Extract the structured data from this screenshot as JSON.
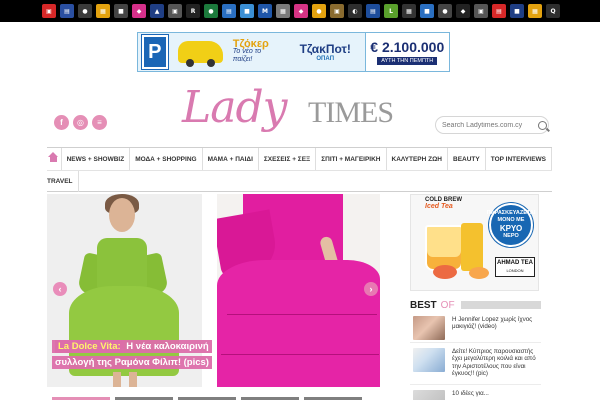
{
  "site_bar": {
    "icons": [
      {
        "name": "site-icon-1",
        "color": "#d62828",
        "glyph": "▣"
      },
      {
        "name": "site-icon-2",
        "color": "#2a4fa1",
        "glyph": "▤"
      },
      {
        "name": "site-icon-3",
        "color": "#3a3a3a",
        "glyph": "●"
      },
      {
        "name": "site-icon-4",
        "color": "#e3a20f",
        "glyph": "▦"
      },
      {
        "name": "site-icon-5",
        "color": "#444444",
        "glyph": "■"
      },
      {
        "name": "site-icon-6",
        "color": "#d6308a",
        "glyph": "◆"
      },
      {
        "name": "site-icon-7",
        "color": "#1f3e84",
        "glyph": "▲"
      },
      {
        "name": "site-icon-8",
        "color": "#555555",
        "glyph": "▣"
      },
      {
        "name": "site-icon-9",
        "color": "#222222",
        "glyph": "R"
      },
      {
        "name": "site-icon-10",
        "color": "#1c7a3c",
        "glyph": "●"
      },
      {
        "name": "site-icon-11",
        "color": "#2a6fc1",
        "glyph": "▤"
      },
      {
        "name": "site-icon-12",
        "color": "#3b8fd4",
        "glyph": "■"
      },
      {
        "name": "site-icon-13",
        "color": "#1f56a8",
        "glyph": "M"
      },
      {
        "name": "site-icon-14",
        "color": "#7a7a7a",
        "glyph": "▦"
      },
      {
        "name": "site-icon-15",
        "color": "#d63384",
        "glyph": "◆"
      },
      {
        "name": "site-icon-16",
        "color": "#e3a20f",
        "glyph": "●"
      },
      {
        "name": "site-icon-17",
        "color": "#8a6b2f",
        "glyph": "▣"
      },
      {
        "name": "site-icon-18",
        "color": "#2e2e2e",
        "glyph": "◐"
      },
      {
        "name": "site-icon-19",
        "color": "#1d4d9c",
        "glyph": "▤"
      },
      {
        "name": "site-icon-20",
        "color": "#5aa02c",
        "glyph": "L"
      },
      {
        "name": "site-icon-21",
        "color": "#333333",
        "glyph": "▦"
      },
      {
        "name": "site-icon-22",
        "color": "#2a6fc1",
        "glyph": "■"
      },
      {
        "name": "site-icon-23",
        "color": "#444444",
        "glyph": "●"
      },
      {
        "name": "site-icon-24",
        "color": "#222222",
        "glyph": "◆"
      },
      {
        "name": "site-icon-25",
        "color": "#555555",
        "glyph": "▣"
      },
      {
        "name": "site-icon-26",
        "color": "#d62828",
        "glyph": "▤"
      },
      {
        "name": "site-icon-27",
        "color": "#1f3e84",
        "glyph": "■"
      },
      {
        "name": "site-icon-28",
        "color": "#e3a20f",
        "glyph": "▦"
      },
      {
        "name": "site-icon-29",
        "color": "#2e2e2e",
        "glyph": "Q"
      }
    ]
  },
  "banner": {
    "sign": "P",
    "brand": "Τζόκερ",
    "slogan": "Το νέο το παίζει!",
    "headline": "ΤζακΠοτ!",
    "sponsor": "ΟΠΑΠ",
    "amount": "€ 2.100.000",
    "draw_day": "ΑΥΤΗ ΤΗΝ ΠΕΜΠΤΗ"
  },
  "social": [
    {
      "name": "facebook-icon",
      "glyph": "f"
    },
    {
      "name": "instagram-icon",
      "glyph": "◎"
    },
    {
      "name": "rss-icon",
      "glyph": "≡"
    }
  ],
  "logo": {
    "part1": "Lady",
    "part2": "TIMES"
  },
  "search": {
    "placeholder": "Search Ladytimes.com.cy"
  },
  "nav": {
    "row1": [
      "NEWS + SHOWBIZ",
      "ΜΟΔΑ + SHOPPING",
      "ΜΑΜΑ + ΠΑΙΔΙ",
      "ΣΧΕΣΕΙΣ + ΣΕΞ",
      "ΣΠΙΤΙ + ΜΑΓΕΙΡΙΚΗ",
      "ΚΑΛΥΤΕΡΗ ΖΩΗ",
      "BEAUTY",
      "TOP INTERVIEWS"
    ],
    "row2": [
      "TRAVEL"
    ]
  },
  "hero": {
    "caption_highlight": "La Dolce Vita:",
    "caption_rest": "Η νέα καλοκαιρινή συλλογή της Ραμόνα Φίλιπ! (pics)",
    "prev_glyph": "‹",
    "next_glyph": "›"
  },
  "side_ad": {
    "top_line": "COLD BREW",
    "top_sub": "Iced Tea",
    "badge_line1": "ΠΑΡΑΣΚΕΥΑΖΕΤΑΙ",
    "badge_line2": "ΜΟΝΟ ΜΕ",
    "badge_big": "ΚΡΥΟ",
    "badge_line3": "ΝΕΡΟ",
    "brand": "AHMAD TEA",
    "brand_sub": "LONDON"
  },
  "best_of": {
    "title_a": "BEST",
    "title_b": "OF",
    "items": [
      {
        "title": "Η Jennifer Lopez χωρίς ίχνος μακιγιάζ! (video)"
      },
      {
        "title": "Δείτε! Κύπριος παρουσιαστής έχει μεγαλύτερη κοιλιά και από την Αριστοτέλους που είναι έγκυος!! (pic)"
      },
      {
        "title": "10 ιδέες για..."
      }
    ]
  }
}
